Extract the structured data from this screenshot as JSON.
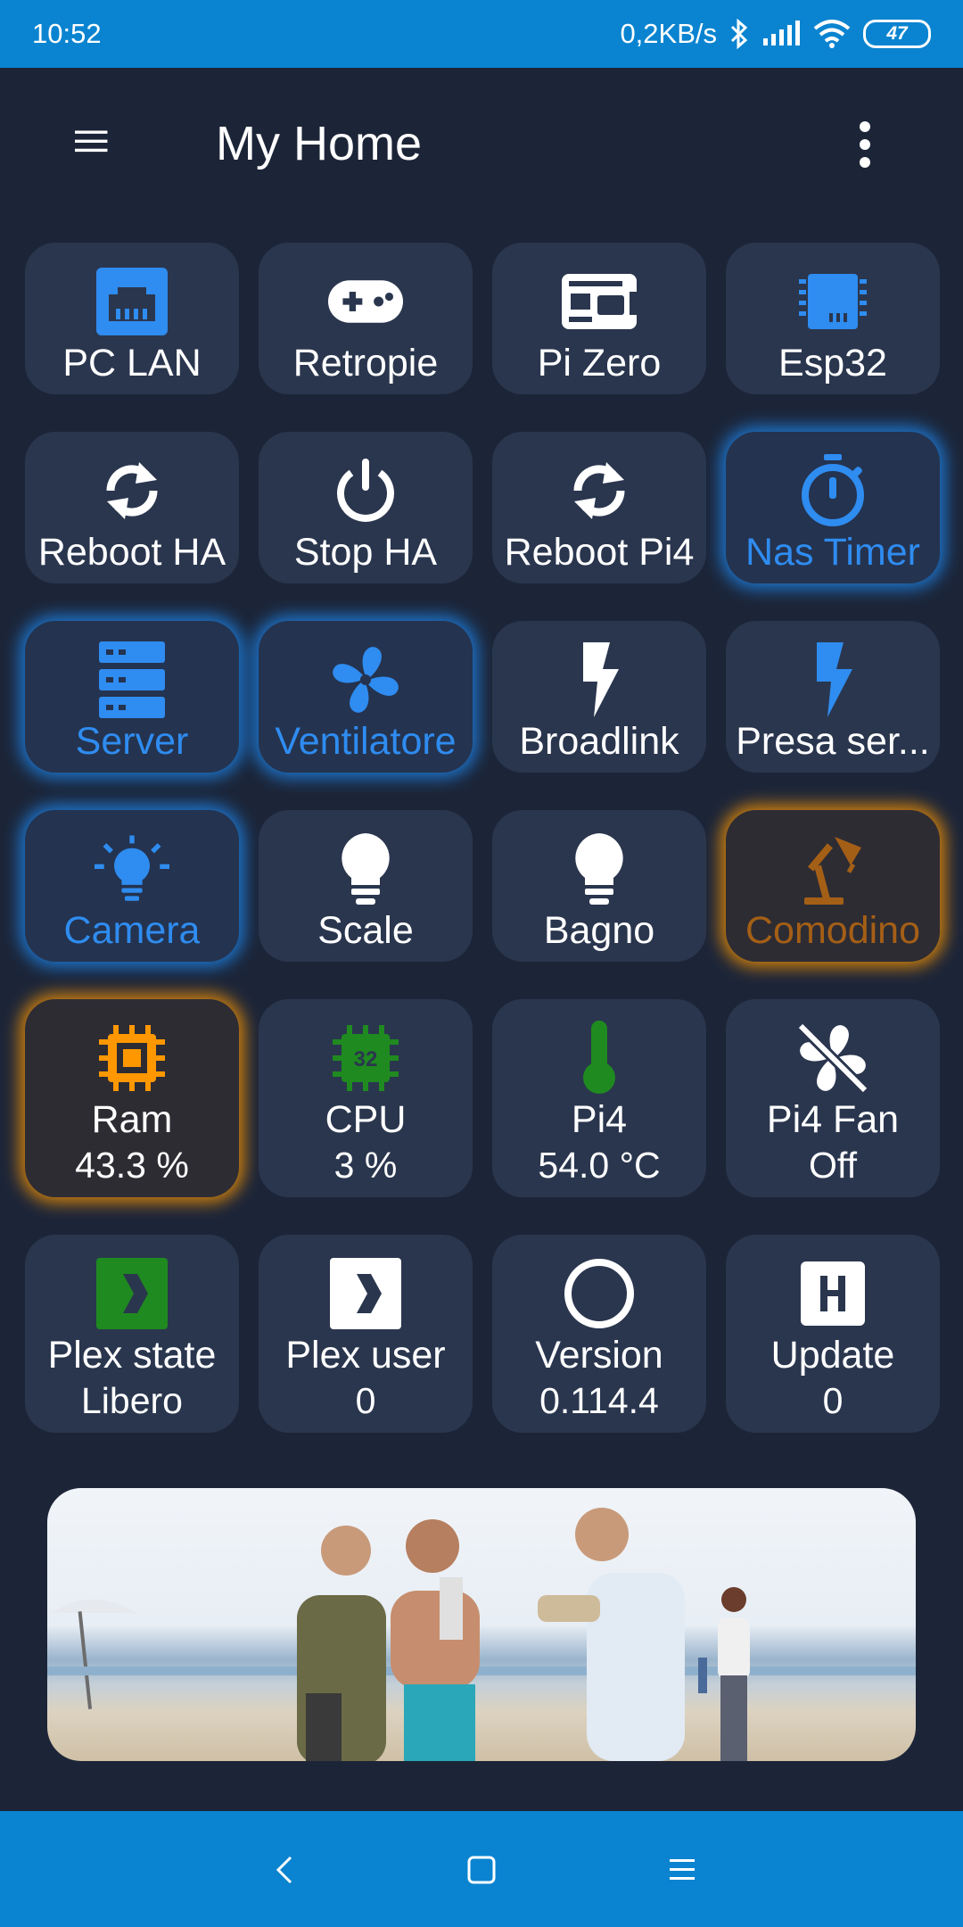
{
  "status_bar": {
    "time": "10:52",
    "net_speed": "0,2KB/s",
    "battery": "47",
    "icons": [
      "bluetooth-icon",
      "signal-icon",
      "wifi-icon",
      "battery-icon"
    ]
  },
  "app_bar": {
    "title": "My Home",
    "menu_icon": "hamburger-menu-icon",
    "more_icon": "more-vert-icon"
  },
  "colors": {
    "background": "#1c2538",
    "tile": "#2a364e",
    "accent_blue": "#2f8cf0",
    "accent_orange": "#ff9800",
    "status_bar": "#0a84d0",
    "green": "#1f8a1f"
  },
  "tiles": [
    {
      "label": "PC LAN",
      "icon": "ethernet-icon",
      "state": "off"
    },
    {
      "label": "Retropie",
      "icon": "gamepad-icon",
      "state": "off"
    },
    {
      "label": "Pi Zero",
      "icon": "raspberry-board-icon",
      "state": "off"
    },
    {
      "label": "Esp32",
      "icon": "chip-icon",
      "state": "off"
    },
    {
      "label": "Reboot HA",
      "icon": "refresh-icon",
      "state": "off"
    },
    {
      "label": "Stop HA",
      "icon": "power-icon",
      "state": "off"
    },
    {
      "label": "Reboot Pi4",
      "icon": "refresh-icon",
      "state": "off"
    },
    {
      "label": "Nas Timer",
      "icon": "timer-icon",
      "state": "on"
    },
    {
      "label": "Server",
      "icon": "server-icon",
      "state": "on"
    },
    {
      "label": "Ventilatore",
      "icon": "fan-icon",
      "state": "on"
    },
    {
      "label": "Broadlink",
      "icon": "flash-icon",
      "state": "off"
    },
    {
      "label": "Presa ser...",
      "icon": "flash-icon",
      "state": "off"
    },
    {
      "label": "Camera",
      "icon": "lightbulb-on-icon",
      "state": "on"
    },
    {
      "label": "Scale",
      "icon": "lightbulb-icon",
      "state": "off"
    },
    {
      "label": "Bagno",
      "icon": "lightbulb-icon",
      "state": "off"
    },
    {
      "label": "Comodino",
      "icon": "desk-lamp-icon",
      "state": "on"
    },
    {
      "label": "Ram",
      "value": "43.3 %",
      "icon": "memory-icon",
      "state": "warn"
    },
    {
      "label": "CPU",
      "value": "3 %",
      "icon": "cpu-icon",
      "state": "ok"
    },
    {
      "label": "Pi4",
      "value": "54.0 °C",
      "icon": "thermometer-icon",
      "state": "ok"
    },
    {
      "label": "Pi4 Fan",
      "value": "Off",
      "icon": "fan-off-icon",
      "state": "off"
    },
    {
      "label": "Plex state",
      "value": "Libero",
      "icon": "plex-icon",
      "state": "ok"
    },
    {
      "label": "Plex user",
      "value": "0",
      "icon": "plex-icon",
      "state": "off"
    },
    {
      "label": "Version",
      "value": "0.114.4",
      "icon": "circle-outline-icon",
      "state": "off"
    },
    {
      "label": "Update",
      "value": "0",
      "icon": "home-assistant-icon",
      "state": "off"
    }
  ],
  "media_card": {
    "image": "media-artwork-image"
  },
  "nav_bar": {
    "icons": [
      "back-icon",
      "home-square-icon",
      "recents-menu-icon"
    ]
  }
}
